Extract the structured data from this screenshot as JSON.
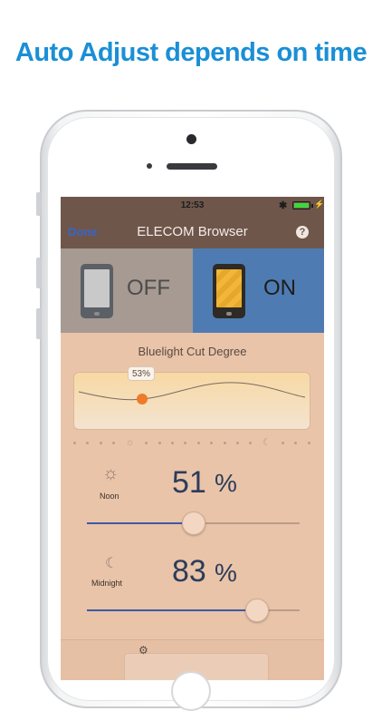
{
  "headline": "Auto Adjust depends on time",
  "status_bar": {
    "time": "12:53",
    "bluetooth_icon": "bluetooth-icon",
    "battery_icon": "battery-icon"
  },
  "nav": {
    "done_label": "Done",
    "title": "ELECOM Browser",
    "help_label": "?"
  },
  "toggle": {
    "off_label": "OFF",
    "on_label": "ON",
    "selected": "ON"
  },
  "degree": {
    "title": "Bluelight Cut Degree",
    "current_percent": "53%"
  },
  "noon": {
    "label": "Noon",
    "value": "51",
    "unit": "%",
    "slider_fraction": 0.51
  },
  "midnight": {
    "label": "Midnight",
    "value": "83",
    "unit": "%",
    "slider_fraction": 0.83
  },
  "colors": {
    "headline": "#1a8fd6",
    "on_panel": "#4e7cb2",
    "screen_bg": "#e9c4a9",
    "navbar": "#6e564a",
    "slider": "#3f5aa6"
  }
}
